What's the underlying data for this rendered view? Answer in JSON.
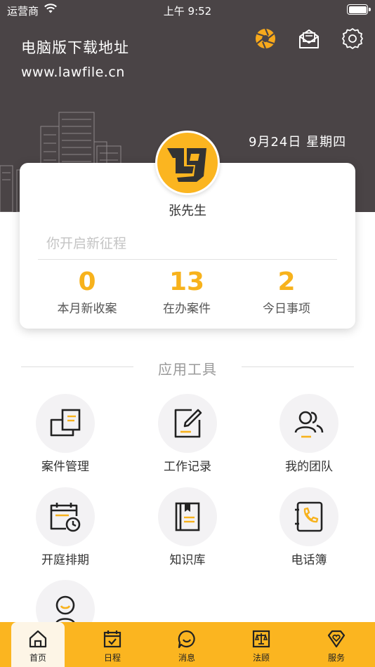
{
  "status_bar": {
    "carrier": "运营商",
    "time": "上午 9:52"
  },
  "header": {
    "download_title": "电脑版下载地址",
    "download_url": "www.lawfile.cn",
    "date": "9月24日 星期四"
  },
  "profile": {
    "name": "张先生",
    "marquee": "你开启新征程"
  },
  "stats": [
    {
      "value": "0",
      "label": "本月新收案"
    },
    {
      "value": "13",
      "label": "在办案件"
    },
    {
      "value": "2",
      "label": "今日事项"
    }
  ],
  "section": {
    "title": "应用工具"
  },
  "tools": [
    {
      "label": "案件管理",
      "icon": "folders-icon"
    },
    {
      "label": "工作记录",
      "icon": "edit-note-icon"
    },
    {
      "label": "我的团队",
      "icon": "team-icon"
    },
    {
      "label": "开庭排期",
      "icon": "calendar-clock-icon"
    },
    {
      "label": "知识库",
      "icon": "book-icon"
    },
    {
      "label": "电话簿",
      "icon": "phone-book-icon"
    },
    {
      "label": "",
      "icon": "person-icon"
    }
  ],
  "tabs": [
    {
      "label": "首页",
      "icon": "home-icon",
      "active": true
    },
    {
      "label": "日程",
      "icon": "calendar-check-icon",
      "active": false
    },
    {
      "label": "消息",
      "icon": "message-icon",
      "active": false
    },
    {
      "label": "法顾",
      "icon": "scales-icon",
      "active": false
    },
    {
      "label": "服务",
      "icon": "diamond-heart-icon",
      "active": false
    }
  ],
  "colors": {
    "accent": "#fbb520",
    "header_bg": "#4a4446",
    "stat_value": "#f7b21c"
  }
}
